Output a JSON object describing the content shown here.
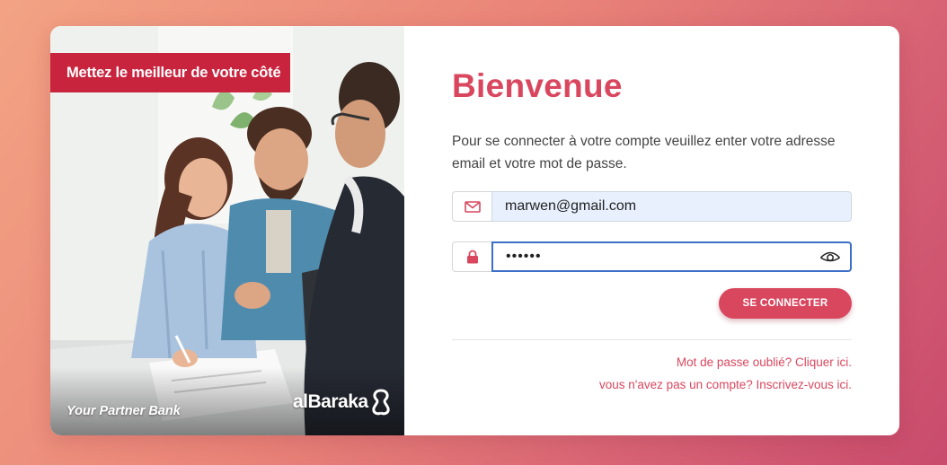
{
  "promo": {
    "tagline": "Mettez le meilleur de votre côté",
    "partner_text": "Your Partner Bank",
    "brand_name": "alBaraka",
    "brand_logo_icon": "albaraka-logo-icon"
  },
  "login": {
    "title": "Bienvenue",
    "subtitle": "Pour se connecter à votre compte veuillez enter votre adresse email et votre mot de passe.",
    "email": {
      "icon": "envelope-icon",
      "value": "marwen@gmail.com"
    },
    "password": {
      "icon": "lock-icon",
      "value": "••••••",
      "toggle_icon": "eye-icon"
    },
    "submit_label": "SE CONNECTER",
    "forgot_link": "Mot de passe oublié? Cliquer ici.",
    "register_link": "vous n'avez pas un compte? Inscrivez-vous ici."
  },
  "colors": {
    "accent": "#d9475f",
    "tagline_bg": "#c8243e",
    "email_field_bg": "#e8f0fe",
    "password_focus_border": "#3b6fc8"
  }
}
